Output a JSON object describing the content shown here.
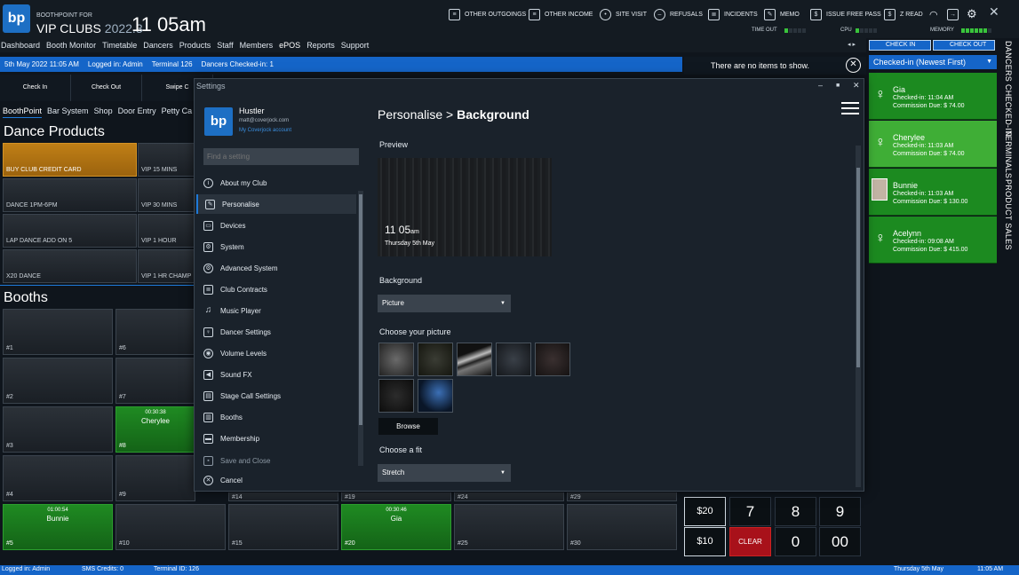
{
  "header": {
    "brand_small": "BOOTHPOINT FOR",
    "brand_main": "VIP CLUBS",
    "version": "2022.3",
    "clock": "11 05am",
    "toolbar": [
      {
        "label": "OTHER OUTGOINGS",
        "icon": "list-icon"
      },
      {
        "label": "OTHER INCOME",
        "icon": "list-icon"
      },
      {
        "label": "SITE VISIT",
        "icon": "person-icon"
      },
      {
        "label": "REFUSALS",
        "icon": "no-entry-icon"
      },
      {
        "label": "INCIDENTS",
        "icon": "document-icon"
      },
      {
        "label": "MEMO",
        "icon": "memo-icon"
      },
      {
        "label": "ISSUE FREE PASS",
        "icon": "dollar-icon"
      },
      {
        "label": "Z READ",
        "icon": "dollar-icon"
      }
    ],
    "time_out_label": "TIME OUT",
    "cpu_label": "CPU",
    "memory_label": "MEMORY"
  },
  "nav": {
    "items": [
      "Dashboard",
      "Booth Monitor",
      "Timetable",
      "Dancers",
      "Products",
      "Staff",
      "Members",
      "ePOS",
      "Reports",
      "Support"
    ]
  },
  "status_strip": {
    "date": "5th May 2022 11:05 AM",
    "logged_in": "Logged in: Admin",
    "terminal": "Terminal 126",
    "dancers": "Dancers Checked-in: 1"
  },
  "empty_message": "There are no items to show.",
  "pos_tabs": [
    "Check In",
    "Check Out",
    "Swipe C"
  ],
  "subnav": [
    "BoothPoint",
    "Bar System",
    "Shop",
    "Door Entry",
    "Petty Ca"
  ],
  "dance_products": {
    "title": "Dance Products",
    "items": [
      "BUY CLUB CREDIT CARD",
      "VIP 15 MINS",
      "DANCE 1PM-6PM",
      "VIP 30 MINS",
      "LAP DANCE ADD ON 5",
      "VIP 1 HOUR",
      "X20 DANCE",
      "VIP 1 HR CHAMP"
    ]
  },
  "booths": {
    "title": "Booths",
    "tiles": [
      {
        "num": "#1"
      },
      {
        "num": "#6"
      },
      {
        "num": "#2"
      },
      {
        "num": "#7"
      },
      {
        "num": "#3"
      },
      {
        "num": "#8",
        "time": "00:30:38",
        "name": "Cherylee"
      },
      {
        "num": "#4"
      },
      {
        "num": "#9"
      },
      {
        "num": "#5",
        "time": "01:00:54",
        "name": "Bunnie"
      },
      {
        "num": "#10"
      },
      {
        "num": "#14"
      },
      {
        "num": "#19"
      },
      {
        "num": "#24"
      },
      {
        "num": "#29"
      },
      {
        "num": "#15"
      },
      {
        "num": "#20",
        "time": "00:30:46",
        "name": "Gia"
      },
      {
        "num": "#25"
      },
      {
        "num": "#30"
      }
    ]
  },
  "right_panel": {
    "check_in": "CHECK IN",
    "check_out": "CHECK OUT",
    "sort": "Checked-in (Newest First)",
    "dancers": [
      {
        "name": "Gia",
        "checked_in": "Checked-in: 11:04 AM",
        "commission": "Commission  Due: $ 74.00"
      },
      {
        "name": "Cherylee",
        "checked_in": "Checked-in: 11:03 AM",
        "commission": "Commission  Due: $ 74.00"
      },
      {
        "name": "Bunnie",
        "checked_in": "Checked-in: 11:03 AM",
        "commission": "Commission  Due: $ 130.00"
      },
      {
        "name": "Acelynn",
        "checked_in": "Checked-in: 09:08 AM",
        "commission": "Commission  Due: $ 415.00"
      }
    ],
    "vertical_tabs": [
      "DANCERS CHECKED-IN",
      "TERMINALS",
      "PRODUCT SALES"
    ]
  },
  "numpad": {
    "keys": [
      "$20",
      "7",
      "8",
      "9",
      "$10",
      "CLEAR",
      "0",
      "00"
    ]
  },
  "statusbar": {
    "logged_in": "Logged in: Admin",
    "sms": "SMS Credits: 0",
    "terminal": "Terminal ID: 126",
    "date": "Thursday 5th May",
    "time": "11:05 AM"
  },
  "settings": {
    "window_title": "Settings",
    "user_name": "Hustler",
    "user_email": "matt@coverjock.com",
    "account_link": "My Coverjock account",
    "search_placeholder": "Find a setting",
    "menu": [
      {
        "label": "About my Club",
        "icon": "info-icon"
      },
      {
        "label": "Personalise",
        "icon": "brush-icon"
      },
      {
        "label": "Devices",
        "icon": "devices-icon"
      },
      {
        "label": "System",
        "icon": "system-icon"
      },
      {
        "label": "Advanced System",
        "icon": "gear-icon"
      },
      {
        "label": "Club Contracts",
        "icon": "contract-icon"
      },
      {
        "label": "Music Player",
        "icon": "music-icon"
      },
      {
        "label": "Dancer Settings",
        "icon": "dancer-icon"
      },
      {
        "label": "Volume Levels",
        "icon": "volume-icon"
      },
      {
        "label": "Sound FX",
        "icon": "sound-icon"
      },
      {
        "label": "Stage Call Settings",
        "icon": "stage-icon"
      },
      {
        "label": "Booths",
        "icon": "booth-icon"
      },
      {
        "label": "Membership",
        "icon": "card-icon"
      },
      {
        "label": "Save and Close",
        "icon": "save-icon"
      },
      {
        "label": "Cancel",
        "icon": "cancel-icon"
      }
    ],
    "selected_menu": "Personalise",
    "breadcrumb_parent": "Personalise",
    "breadcrumb_sep": ">",
    "breadcrumb_current": "Background",
    "preview_label": "Preview",
    "preview_time": "11 05",
    "preview_ampm": "am",
    "preview_date": "Thursday 5th May",
    "background_label": "Background",
    "background_value": "Picture",
    "choose_picture_label": "Choose your picture",
    "browse_label": "Browse",
    "choose_fit_label": "Choose a fit",
    "fit_value": "Stretch"
  },
  "colors": {
    "accent_blue": "#1565c8",
    "green_active": "#1c8a20",
    "orange_product": "#c07f16",
    "clear_red": "#a8111a"
  }
}
